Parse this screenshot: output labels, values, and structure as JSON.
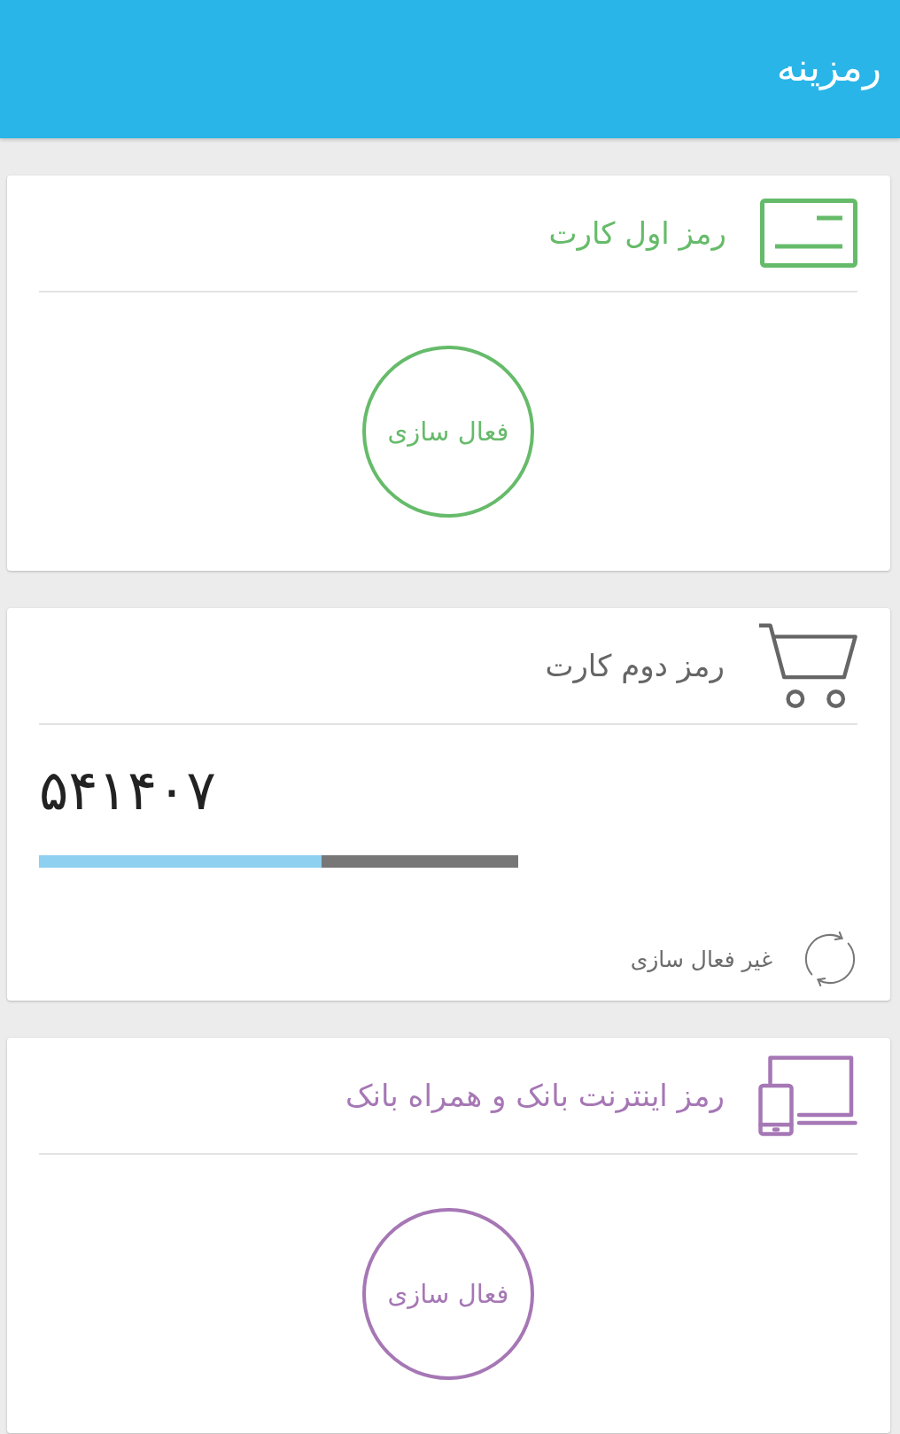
{
  "app_bar": {
    "title": "رمزینه"
  },
  "cards": [
    {
      "kind": "activation",
      "title": "رمز اول کارت",
      "color": "#66bb6a",
      "button": "فعال سازی"
    },
    {
      "kind": "code",
      "title": "رمز دوم کارت",
      "color": "#666666",
      "code": "۵۴۱۴۰۷",
      "level": 0.59,
      "action": "غیر فعال سازی"
    },
    {
      "kind": "activation",
      "title": "رمز اینترنت بانک و همراه بانک",
      "color": "#a677b5",
      "button": "فعال سازی"
    }
  ]
}
